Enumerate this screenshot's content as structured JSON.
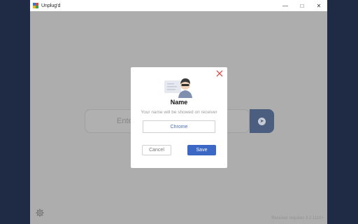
{
  "window": {
    "title": "Unplug'd",
    "controls": {
      "minimize": "—",
      "maximize": "□",
      "close": "✕"
    }
  },
  "main": {
    "input_partial_text": "Ente",
    "go_button_icon": "arrow-right-circle-icon",
    "settings_icon": "gear-icon",
    "footer_text": "Receiver requires 3.2.1110+"
  },
  "dialog": {
    "close_icon": "close-icon",
    "illustration": "user-avatar-illustration",
    "title": "Name",
    "subtitle": "Your name will be showed on receiver",
    "name_value": "Chrome",
    "cancel_label": "Cancel",
    "save_label": "Save"
  },
  "colors": {
    "accent": "#3a68c4",
    "close_icon": "#d9534f",
    "dimmed_background": "#b9b9b9",
    "go_button": "#4b5f85"
  }
}
